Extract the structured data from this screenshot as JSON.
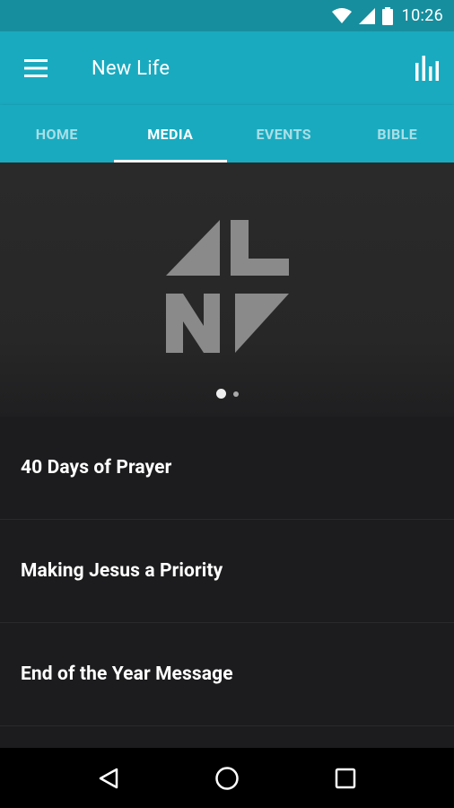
{
  "status_bar": {
    "time": "10:26",
    "icons": [
      "wifi-icon",
      "signal-icon",
      "battery-icon"
    ]
  },
  "app_bar": {
    "title": "New Life",
    "left_icon": "menu-icon",
    "right_icon": "bar-chart-icon"
  },
  "tabs": [
    {
      "label": "HOME",
      "active": false
    },
    {
      "label": "MEDIA",
      "active": true
    },
    {
      "label": "EVENTS",
      "active": false
    },
    {
      "label": "BIBLE",
      "active": false
    }
  ],
  "banner": {
    "logo": "new-life-logo",
    "carousel_pages": 2,
    "current_page": 1
  },
  "media_items": [
    {
      "title": "40 Days of Prayer"
    },
    {
      "title": "Making Jesus a Priority"
    },
    {
      "title": "End of the Year Message"
    }
  ],
  "nav_bar": {
    "icons": [
      "back-icon",
      "home-icon",
      "recents-icon"
    ]
  },
  "colors": {
    "status_bar": "#168e9e",
    "app_bar": "#1aaabf",
    "background": "#1c1c1e"
  }
}
